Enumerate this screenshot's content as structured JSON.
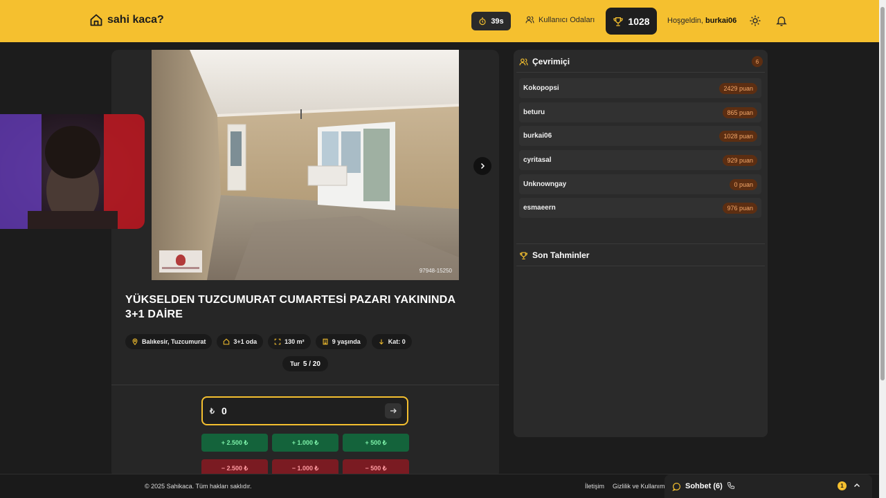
{
  "header": {
    "brand": "sahi kaca?",
    "timer": "39s",
    "rooms_link": "Kullanıcı Odaları",
    "score": "1028",
    "welcome_prefix": "Hoşgeldin,",
    "username": "burkai06",
    "accent_color": "#f5c02f"
  },
  "listing": {
    "photo_code": "97948-15250",
    "title": "YÜKSELDEN TUZCUMURAT CUMARTESİ PAZARI YAKININDA 3+1 DAİRE",
    "location": "Balıkesir, Tuzcumurat",
    "rooms": "3+1 oda",
    "area": "130 m²",
    "age": "9 yaşında",
    "floor": "Kat: 0",
    "round_label": "Tur",
    "round_value": "5 / 20"
  },
  "guess": {
    "currency": "₺",
    "value": "0",
    "plus_buttons": [
      "+ 2.500 ₺",
      "+ 1.000 ₺",
      "+ 500 ₺"
    ],
    "minus_buttons": [
      "− 2.500 ₺",
      "− 1.000 ₺",
      "− 500 ₺"
    ]
  },
  "online": {
    "title": "Çevrimiçi",
    "count": "6",
    "users": [
      {
        "name": "Kokopopsi",
        "score": "2429 puan"
      },
      {
        "name": "beturu",
        "score": "865 puan"
      },
      {
        "name": "burkai06",
        "score": "1028 puan"
      },
      {
        "name": "cyritasal",
        "score": "929 puan"
      },
      {
        "name": "Unknowngay",
        "score": "0 puan"
      },
      {
        "name": "esmaeern",
        "score": "976 puan"
      }
    ]
  },
  "recent": {
    "title": "Son Tahminler"
  },
  "footer": {
    "copyright": "© 2025 Sahikaca. Tüm hakları saklıdır.",
    "contact": "İletişim",
    "privacy": "Gizlilik ve Kullanım",
    "chat_label": "Sohbet (6)",
    "chat_unread": "1"
  }
}
